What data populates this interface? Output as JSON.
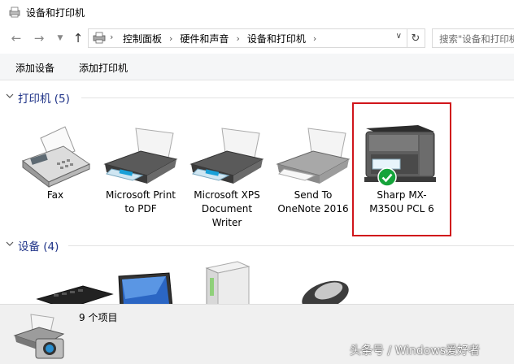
{
  "window": {
    "title": "设备和打印机"
  },
  "breadcrumb": {
    "items": [
      "控制面板",
      "硬件和声音",
      "设备和打印机"
    ]
  },
  "search": {
    "placeholder": "搜索\"设备和打印机\""
  },
  "toolbar": {
    "add_device": "添加设备",
    "add_printer": "添加打印机"
  },
  "groups": {
    "printers": {
      "title": "打印机 (5)"
    },
    "devices": {
      "title": "设备 (4)"
    }
  },
  "printers": [
    {
      "name": "Fax",
      "icon": "fax-icon"
    },
    {
      "name": "Microsoft Print to PDF",
      "icon": "printer-icon"
    },
    {
      "name": "Microsoft XPS Document Writer",
      "icon": "printer-icon"
    },
    {
      "name": "Send To OneNote 2016",
      "icon": "printer-icon"
    },
    {
      "name": "Sharp MX-M350U PCL 6",
      "icon": "mfp-printer-icon",
      "default": true
    }
  ],
  "devices": [
    {
      "icon": "keyboard-icon"
    },
    {
      "icon": "monitor-icon"
    },
    {
      "icon": "tower-pc-icon"
    },
    {
      "icon": "mouse-icon"
    }
  ],
  "status": {
    "item_count": "9 个项目"
  },
  "watermark": "头条号 / Windows爱好者",
  "colors": {
    "group_title": "#1e3287",
    "highlight": "#d0151b",
    "default_check": "#15a33a"
  }
}
